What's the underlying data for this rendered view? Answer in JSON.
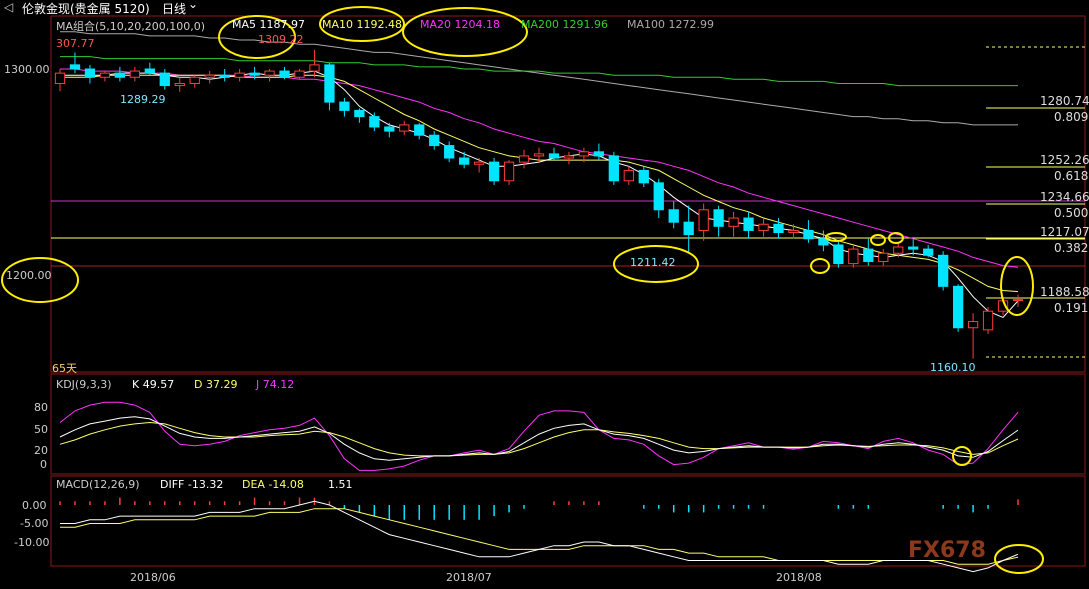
{
  "topbar": {
    "back_glyph": "◁",
    "instrument": "伦敦金现(贵金属 5120)",
    "period": "日线",
    "dropdown_glyph": "⌄"
  },
  "ma_legend": {
    "group": "MA组合(5,10,20,200,100,0)",
    "ma5": "MA5 1187.97",
    "ma10": "MA10 1192.48",
    "ma20": "MA20 1204.18",
    "ma200": "MA200 1291.96",
    "ma100": "MA100 1272.99"
  },
  "price_panel": {
    "top_label": "307.77",
    "high_label": "1309.22",
    "low1_label": "1289.29",
    "low2_label": "1211.42",
    "low3_label": "1160.10",
    "current_label": "1188.58",
    "days_label": "65天",
    "yticks": [
      "1300.00",
      "1200.00"
    ],
    "fib": [
      {
        "price": "1280.74",
        "ratio": "0.809"
      },
      {
        "price": "1252.26",
        "ratio": "0.618"
      },
      {
        "price": "1234.66",
        "ratio": "0.500"
      },
      {
        "price": "1217.07",
        "ratio": "0.382"
      },
      {
        "price": "",
        "ratio": "0.191"
      }
    ]
  },
  "kdj": {
    "title": "KDJ(9,3,3)",
    "k": "K 49.57",
    "d": "D 37.29",
    "j": "J 74.12",
    "yticks": [
      "80",
      "50",
      "20",
      "0"
    ]
  },
  "macd": {
    "title": "MACD(12,26,9)",
    "diff": "DIFF -13.32",
    "dea": "DEA -14.08",
    "macd": "1.51",
    "yticks": [
      "0.00",
      "-5.00",
      "-10.00"
    ]
  },
  "xaxis": [
    "2018/06",
    "2018/07",
    "2018/08"
  ],
  "watermark": "FX678",
  "colors": {
    "up": "#ff3b3b",
    "down": "#00e5ff",
    "ma5": "#ffffff",
    "ma10": "#ffff66",
    "ma20": "#ff33ff",
    "ma200": "#33cc33",
    "ma100": "#aaaaaa",
    "circle": "#ffee00"
  },
  "chart_data": {
    "type": "candlestick",
    "title": "伦敦金现(贵金属 5120) 日线",
    "ylim": [
      1155,
      1315
    ],
    "candles": [
      {
        "o": 1293,
        "h": 1300,
        "l": 1289.29,
        "c": 1298
      },
      {
        "o": 1302,
        "h": 1308,
        "l": 1298,
        "c": 1300
      },
      {
        "o": 1300,
        "h": 1302,
        "l": 1293,
        "c": 1296
      },
      {
        "o": 1296,
        "h": 1299,
        "l": 1294,
        "c": 1298
      },
      {
        "o": 1298,
        "h": 1301,
        "l": 1294,
        "c": 1296
      },
      {
        "o": 1296,
        "h": 1301,
        "l": 1294,
        "c": 1299
      },
      {
        "o": 1300,
        "h": 1303,
        "l": 1297,
        "c": 1298
      },
      {
        "o": 1298,
        "h": 1300,
        "l": 1290,
        "c": 1292
      },
      {
        "o": 1292,
        "h": 1296,
        "l": 1289,
        "c": 1293
      },
      {
        "o": 1293,
        "h": 1297,
        "l": 1291,
        "c": 1296
      },
      {
        "o": 1296,
        "h": 1299,
        "l": 1293,
        "c": 1297
      },
      {
        "o": 1297,
        "h": 1300,
        "l": 1294,
        "c": 1296
      },
      {
        "o": 1296,
        "h": 1300,
        "l": 1294,
        "c": 1298
      },
      {
        "o": 1298,
        "h": 1301,
        "l": 1295,
        "c": 1297
      },
      {
        "o": 1297,
        "h": 1300,
        "l": 1294,
        "c": 1299
      },
      {
        "o": 1299,
        "h": 1301,
        "l": 1295,
        "c": 1296
      },
      {
        "o": 1296,
        "h": 1300,
        "l": 1295,
        "c": 1299
      },
      {
        "o": 1299,
        "h": 1309.22,
        "l": 1296,
        "c": 1302
      },
      {
        "o": 1302,
        "h": 1303,
        "l": 1280,
        "c": 1284
      },
      {
        "o": 1284,
        "h": 1286,
        "l": 1277,
        "c": 1280
      },
      {
        "o": 1280,
        "h": 1281,
        "l": 1274,
        "c": 1277
      },
      {
        "o": 1277,
        "h": 1279,
        "l": 1270,
        "c": 1272
      },
      {
        "o": 1272,
        "h": 1274,
        "l": 1267,
        "c": 1270
      },
      {
        "o": 1270,
        "h": 1275,
        "l": 1268,
        "c": 1273
      },
      {
        "o": 1273,
        "h": 1274,
        "l": 1266,
        "c": 1268
      },
      {
        "o": 1268,
        "h": 1270,
        "l": 1261,
        "c": 1263
      },
      {
        "o": 1263,
        "h": 1265,
        "l": 1255,
        "c": 1257
      },
      {
        "o": 1257,
        "h": 1260,
        "l": 1252,
        "c": 1254
      },
      {
        "o": 1254,
        "h": 1257,
        "l": 1250,
        "c": 1255
      },
      {
        "o": 1255,
        "h": 1257,
        "l": 1244,
        "c": 1246
      },
      {
        "o": 1246,
        "h": 1256,
        "l": 1244,
        "c": 1255
      },
      {
        "o": 1255,
        "h": 1261,
        "l": 1252,
        "c": 1258
      },
      {
        "o": 1258,
        "h": 1262,
        "l": 1255,
        "c": 1259
      },
      {
        "o": 1259,
        "h": 1262,
        "l": 1256,
        "c": 1257
      },
      {
        "o": 1257,
        "h": 1260,
        "l": 1254,
        "c": 1258
      },
      {
        "o": 1258,
        "h": 1262,
        "l": 1255,
        "c": 1260
      },
      {
        "o": 1260,
        "h": 1264,
        "l": 1256,
        "c": 1258
      },
      {
        "o": 1258,
        "h": 1260,
        "l": 1244,
        "c": 1246
      },
      {
        "o": 1246,
        "h": 1253,
        "l": 1244,
        "c": 1251
      },
      {
        "o": 1251,
        "h": 1253,
        "l": 1243,
        "c": 1245
      },
      {
        "o": 1245,
        "h": 1247,
        "l": 1228,
        "c": 1232
      },
      {
        "o": 1232,
        "h": 1236,
        "l": 1223,
        "c": 1226
      },
      {
        "o": 1226,
        "h": 1234,
        "l": 1211.42,
        "c": 1220
      },
      {
        "o": 1222,
        "h": 1235,
        "l": 1217,
        "c": 1232
      },
      {
        "o": 1232,
        "h": 1234,
        "l": 1219,
        "c": 1224
      },
      {
        "o": 1224,
        "h": 1231,
        "l": 1219,
        "c": 1228
      },
      {
        "o": 1228,
        "h": 1231,
        "l": 1218,
        "c": 1222
      },
      {
        "o": 1222,
        "h": 1228,
        "l": 1219,
        "c": 1225
      },
      {
        "o": 1225,
        "h": 1228,
        "l": 1218,
        "c": 1221
      },
      {
        "o": 1221,
        "h": 1225,
        "l": 1218,
        "c": 1222
      },
      {
        "o": 1222,
        "h": 1227,
        "l": 1216,
        "c": 1218
      },
      {
        "o": 1218,
        "h": 1222,
        "l": 1212,
        "c": 1215
      },
      {
        "o": 1215,
        "h": 1217,
        "l": 1204,
        "c": 1206
      },
      {
        "o": 1206,
        "h": 1215,
        "l": 1204,
        "c": 1213
      },
      {
        "o": 1213,
        "h": 1218,
        "l": 1205,
        "c": 1207
      },
      {
        "o": 1207,
        "h": 1213,
        "l": 1205,
        "c": 1211
      },
      {
        "o": 1211,
        "h": 1216,
        "l": 1209,
        "c": 1214
      },
      {
        "o": 1214,
        "h": 1218,
        "l": 1210,
        "c": 1213
      },
      {
        "o": 1213,
        "h": 1215,
        "l": 1209,
        "c": 1210
      },
      {
        "o": 1210,
        "h": 1212,
        "l": 1193,
        "c": 1195
      },
      {
        "o": 1195,
        "h": 1196,
        "l": 1173,
        "c": 1175
      },
      {
        "o": 1175,
        "h": 1182,
        "l": 1160.1,
        "c": 1178
      },
      {
        "o": 1174,
        "h": 1185,
        "l": 1172,
        "c": 1183
      },
      {
        "o": 1183,
        "h": 1190,
        "l": 1181,
        "c": 1188
      },
      {
        "o": 1188.58,
        "h": 1191,
        "l": 1185,
        "c": 1188.58
      }
    ],
    "ma5": [
      1297,
      1297,
      1297,
      1297,
      1298,
      1298,
      1298,
      1297,
      1296,
      1296,
      1295,
      1296,
      1297,
      1298,
      1297,
      1297,
      1298,
      1299,
      1296,
      1290,
      1282,
      1277,
      1273,
      1271,
      1269,
      1266,
      1262,
      1259,
      1256,
      1253,
      1253,
      1254,
      1255,
      1257,
      1258,
      1259,
      1258,
      1255,
      1253,
      1249,
      1244,
      1238,
      1233,
      1228,
      1227,
      1226,
      1225,
      1224,
      1223,
      1222,
      1220,
      1218,
      1213,
      1211,
      1210,
      1209,
      1210,
      1211,
      1210,
      1207,
      1199,
      1190,
      1183,
      1180,
      1187.97
    ],
    "ma10": [
      1296,
      1296,
      1296,
      1297,
      1297,
      1297,
      1297,
      1297,
      1297,
      1297,
      1297,
      1297,
      1296,
      1296,
      1296,
      1296,
      1297,
      1297,
      1296,
      1294,
      1290,
      1286,
      1282,
      1278,
      1275,
      1271,
      1268,
      1265,
      1262,
      1260,
      1258,
      1257,
      1256,
      1256,
      1256,
      1256,
      1256,
      1256,
      1255,
      1253,
      1251,
      1247,
      1243,
      1239,
      1236,
      1233,
      1231,
      1228,
      1226,
      1224,
      1222,
      1220,
      1217,
      1215,
      1213,
      1211,
      1210,
      1209,
      1208,
      1206,
      1203,
      1199,
      1195,
      1193,
      1192.48
    ],
    "ma20": [
      1300,
      1300,
      1299,
      1299,
      1299,
      1298,
      1298,
      1298,
      1297,
      1297,
      1297,
      1297,
      1297,
      1296,
      1296,
      1296,
      1295,
      1295,
      1294,
      1293,
      1292,
      1290,
      1288,
      1286,
      1284,
      1281,
      1279,
      1276,
      1274,
      1271,
      1269,
      1267,
      1265,
      1264,
      1262,
      1260,
      1259,
      1258,
      1257,
      1256,
      1255,
      1253,
      1251,
      1248,
      1245,
      1243,
      1240,
      1238,
      1236,
      1234,
      1232,
      1230,
      1228,
      1226,
      1224,
      1222,
      1220,
      1218,
      1216,
      1214,
      1212,
      1209,
      1207,
      1205,
      1204.18
    ],
    "ma200": [
      1306,
      1306,
      1306,
      1305,
      1305,
      1305,
      1305,
      1305,
      1305,
      1305,
      1305,
      1305,
      1304,
      1304,
      1304,
      1304,
      1304,
      1304,
      1303,
      1303,
      1303,
      1302,
      1302,
      1302,
      1301,
      1301,
      1301,
      1300,
      1300,
      1299,
      1299,
      1299,
      1299,
      1298,
      1298,
      1298,
      1298,
      1297,
      1297,
      1297,
      1297,
      1296,
      1296,
      1296,
      1296,
      1295,
      1295,
      1295,
      1294,
      1294,
      1294,
      1294,
      1293,
      1293,
      1293,
      1293,
      1292,
      1292,
      1292,
      1292,
      1292,
      1292,
      1292,
      1292,
      1291.96
    ],
    "ma100": [
      1318,
      1318,
      1317,
      1317,
      1317,
      1317,
      1316,
      1316,
      1316,
      1316,
      1315,
      1315,
      1314,
      1314,
      1313,
      1313,
      1312,
      1312,
      1311,
      1310,
      1309,
      1308,
      1308,
      1307,
      1306,
      1305,
      1304,
      1303,
      1302,
      1301,
      1300,
      1299,
      1298,
      1297,
      1296,
      1295,
      1294,
      1293,
      1292,
      1291,
      1290,
      1289,
      1288,
      1287,
      1286,
      1285,
      1284,
      1283,
      1282,
      1281,
      1280,
      1279,
      1278,
      1277,
      1277,
      1276,
      1276,
      1275,
      1275,
      1274,
      1274,
      1273,
      1273,
      1273,
      1272.99
    ],
    "kdj_k": [
      40,
      50,
      58,
      62,
      66,
      68,
      65,
      55,
      45,
      40,
      38,
      38,
      40,
      42,
      44,
      46,
      48,
      54,
      45,
      30,
      18,
      10,
      8,
      10,
      12,
      14,
      14,
      16,
      18,
      16,
      20,
      32,
      44,
      52,
      56,
      58,
      50,
      44,
      42,
      38,
      30,
      22,
      18,
      20,
      24,
      26,
      28,
      26,
      26,
      25,
      26,
      30,
      30,
      28,
      26,
      30,
      32,
      30,
      26,
      22,
      14,
      12,
      20,
      35,
      49.57
    ],
    "kdj_d": [
      30,
      36,
      44,
      50,
      55,
      58,
      60,
      58,
      52,
      46,
      42,
      40,
      40,
      40,
      42,
      43,
      44,
      48,
      46,
      40,
      32,
      24,
      18,
      15,
      14,
      14,
      14,
      15,
      16,
      16,
      18,
      24,
      32,
      40,
      46,
      50,
      50,
      47,
      45,
      42,
      38,
      32,
      26,
      24,
      24,
      25,
      26,
      26,
      26,
      26,
      26,
      28,
      29,
      28,
      27,
      28,
      29,
      29,
      28,
      25,
      20,
      16,
      18,
      28,
      37.29
    ],
    "kdj_j": [
      60,
      76,
      84,
      88,
      88,
      84,
      74,
      48,
      30,
      28,
      30,
      34,
      42,
      46,
      50,
      52,
      56,
      66,
      42,
      10,
      -6,
      -6,
      -4,
      0,
      8,
      14,
      14,
      18,
      22,
      16,
      24,
      48,
      70,
      76,
      76,
      74,
      50,
      38,
      36,
      30,
      14,
      2,
      4,
      12,
      24,
      28,
      32,
      26,
      26,
      23,
      26,
      34,
      32,
      28,
      24,
      34,
      38,
      32,
      22,
      16,
      2,
      4,
      24,
      50,
      74.12
    ],
    "macd_diff": [
      -5,
      -5,
      -4,
      -4,
      -3,
      -3,
      -3,
      -3,
      -3,
      -3,
      -2,
      -2,
      -2,
      -1,
      -1,
      -1,
      0,
      1,
      0,
      -2,
      -4,
      -6,
      -8,
      -9,
      -10,
      -11,
      -12,
      -13,
      -14,
      -14,
      -14,
      -13,
      -12,
      -11,
      -11,
      -10,
      -10,
      -11,
      -11,
      -12,
      -13,
      -14,
      -15,
      -15,
      -15,
      -15,
      -15,
      -15,
      -15,
      -15,
      -15,
      -15,
      -16,
      -16,
      -16,
      -15,
      -15,
      -15,
      -15,
      -16,
      -17,
      -18,
      -17,
      -15,
      -13.32
    ],
    "macd_dea": [
      -6,
      -6,
      -5,
      -5,
      -5,
      -4,
      -4,
      -4,
      -4,
      -4,
      -3,
      -3,
      -3,
      -3,
      -2,
      -2,
      -2,
      -1,
      -1,
      -1,
      -2,
      -3,
      -4,
      -5,
      -6,
      -7,
      -8,
      -9,
      -10,
      -11,
      -12,
      -12,
      -12,
      -12,
      -12,
      -11,
      -11,
      -11,
      -11,
      -11,
      -12,
      -12,
      -13,
      -13,
      -14,
      -14,
      -14,
      -14,
      -15,
      -15,
      -15,
      -15,
      -15,
      -15,
      -15,
      -15,
      -15,
      -15,
      -15,
      -15,
      -16,
      -16,
      -16,
      -15,
      -14.08
    ],
    "macd_hist": [
      1,
      1,
      1,
      1,
      2,
      1,
      1,
      1,
      1,
      1,
      1,
      1,
      1,
      2,
      1,
      1,
      2,
      2,
      1,
      -1,
      -2,
      -3,
      -4,
      -4,
      -4,
      -4,
      -4,
      -4,
      -4,
      -3,
      -2,
      -1,
      0,
      1,
      1,
      1,
      1,
      0,
      0,
      -1,
      -1,
      -2,
      -2,
      -2,
      -1,
      -1,
      -1,
      -1,
      0,
      0,
      0,
      0,
      -1,
      -1,
      -1,
      0,
      0,
      0,
      0,
      -1,
      -1,
      -2,
      -1,
      0,
      1.51
    ]
  }
}
